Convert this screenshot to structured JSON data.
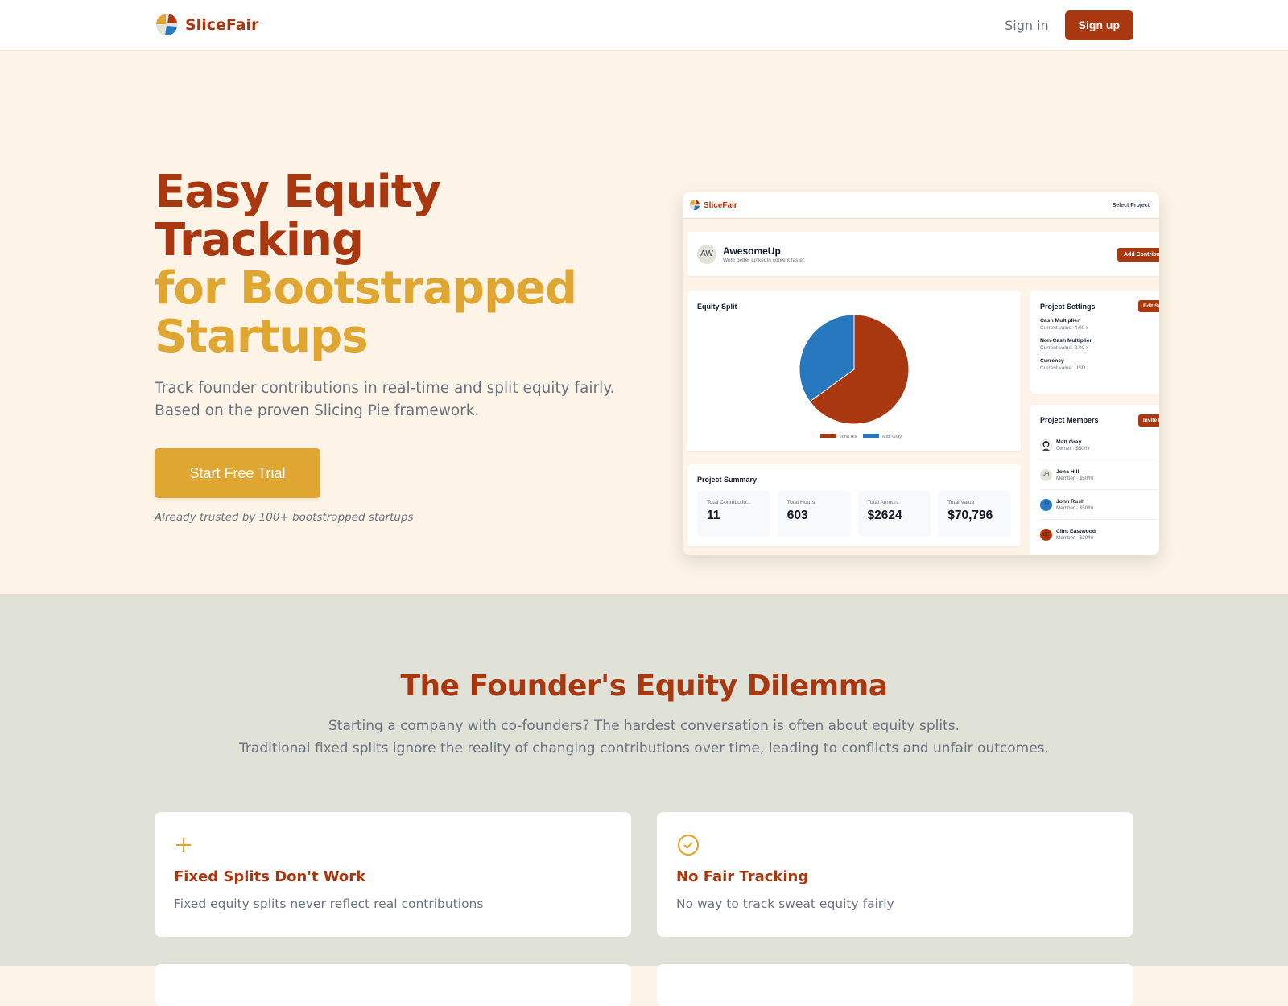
{
  "nav": {
    "brand": "SliceFair",
    "sign_in": "Sign in",
    "sign_up": "Sign up"
  },
  "hero": {
    "title_line1": "Easy Equity Tracking",
    "title_line2": "for Bootstrapped Startups",
    "subtitle_line1": "Track founder contributions in real-time and split equity fairly.",
    "subtitle_line2": "Based on the proven Slicing Pie framework.",
    "cta": "Start Free Trial",
    "trusted": "Already trusted by 100+ bootstrapped startups"
  },
  "mockup": {
    "brand": "SliceFair",
    "select_project": "Select Project",
    "project": {
      "initials": "AW",
      "name": "AwesomeUp",
      "description": "Write better LinkedIn content faster.",
      "add_button": "Add Contribution"
    },
    "equity_title": "Equity Split",
    "summary": {
      "title": "Project Summary",
      "stats": [
        {
          "label": "Total Contributio...",
          "value": "11"
        },
        {
          "label": "Total Hours",
          "value": "603"
        },
        {
          "label": "Total Amount",
          "value": "$2624"
        },
        {
          "label": "Total Value",
          "value": "$70,796"
        }
      ]
    },
    "settings": {
      "title": "Project Settings",
      "edit_button": "Edit Settings",
      "items": [
        {
          "label": "Cash Multiplier",
          "value": "Current value: 4.00 x"
        },
        {
          "label": "Non-Cash Multiplier",
          "value": "Current value: 2.00 x"
        },
        {
          "label": "Currency",
          "value": "Current value: USD"
        }
      ]
    },
    "members": {
      "title": "Project Members",
      "invite_button": "Invite Member",
      "list": [
        {
          "initials": "",
          "name": "Matt Gray",
          "role": "Owner · $50/hr",
          "color": "#ffffff"
        },
        {
          "initials": "JH",
          "name": "Jona Hill",
          "role": "Member · $50/hr",
          "color": "#e1e3d8"
        },
        {
          "initials": "JR",
          "name": "John Rush",
          "role": "Member · $50/hr",
          "color": "#2878c0"
        },
        {
          "initials": "CE",
          "name": "Clint Eastwood",
          "role": "Member · $30/hr",
          "color": "#a93710"
        }
      ]
    }
  },
  "chart_data": {
    "type": "pie",
    "title": "Equity Split",
    "categories": [
      "Jona Hill",
      "Matt Gray"
    ],
    "values": [
      65,
      35
    ],
    "colors": [
      "#a93710",
      "#2878c0"
    ],
    "legend": "bottom"
  },
  "dilemma": {
    "title": "The Founder's Equity Dilemma",
    "line1": "Starting a company with co-founders? The hardest conversation is often about equity splits.",
    "line2": "Traditional fixed splits ignore the reality of changing contributions over time, leading to conflicts and unfair outcomes.",
    "cards": [
      {
        "icon": "plus-icon",
        "title": "Fixed Splits Don't Work",
        "text": "Fixed equity splits never reflect real contributions"
      },
      {
        "icon": "check-circle-icon",
        "title": "No Fair Tracking",
        "text": "No way to track sweat equity fairly"
      }
    ]
  },
  "colors": {
    "primary": "#a93710",
    "accent": "#e0a632",
    "blue": "#2878c0",
    "hero_bg": "#fdf4e7",
    "section_bg": "#e0e2d8"
  }
}
